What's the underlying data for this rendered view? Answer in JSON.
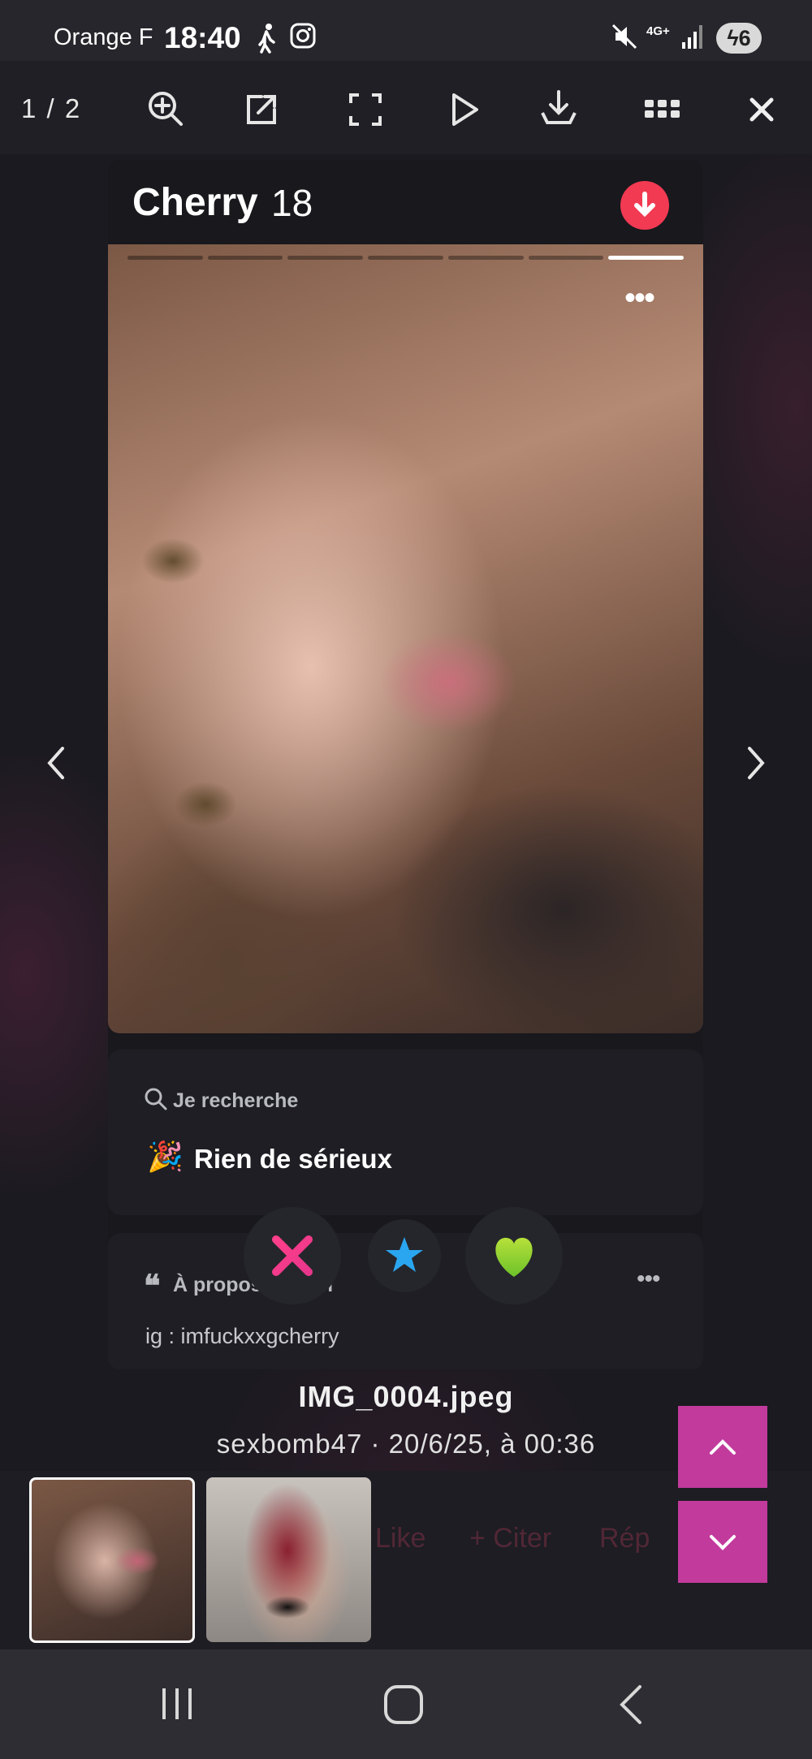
{
  "status_bar": {
    "carrier": "Orange F",
    "time": "18:40",
    "network": "4G+",
    "battery": "6",
    "icons": [
      "walk-icon",
      "instagram-icon",
      "mute-icon",
      "signal-icon",
      "battery-charging-icon"
    ]
  },
  "viewer": {
    "counter": "1 / 2",
    "toolbar_icons": [
      "zoom-in-icon",
      "open-external-icon",
      "fullscreen-icon",
      "play-icon",
      "download-icon",
      "grid-icon",
      "close-icon"
    ]
  },
  "profile": {
    "name": "Cherry",
    "age": "18",
    "photo_count": 7,
    "active_photo": 7,
    "looking_for_label": "Je recherche",
    "looking_for_emoji": "🎉",
    "looking_for_value": "Rien de sérieux",
    "about_label": "À propos de moi",
    "about_text": "ig : imfuckxxgcherry"
  },
  "caption": {
    "filename": "IMG_0004.jpeg",
    "meta": "sexbomb47 · 20/6/25, à 00:36"
  },
  "thumbnails": [
    "thumbnail-1",
    "thumbnail-2"
  ],
  "background_ghost_text": {
    "like": "Like",
    "quote": "+ Citer",
    "reply": "Rép"
  },
  "colors": {
    "accent": "#c23a9c",
    "badge": "#f23a52",
    "nope": "#f0407a",
    "superlike": "#2aa6f0",
    "like": "#8fd12a"
  }
}
